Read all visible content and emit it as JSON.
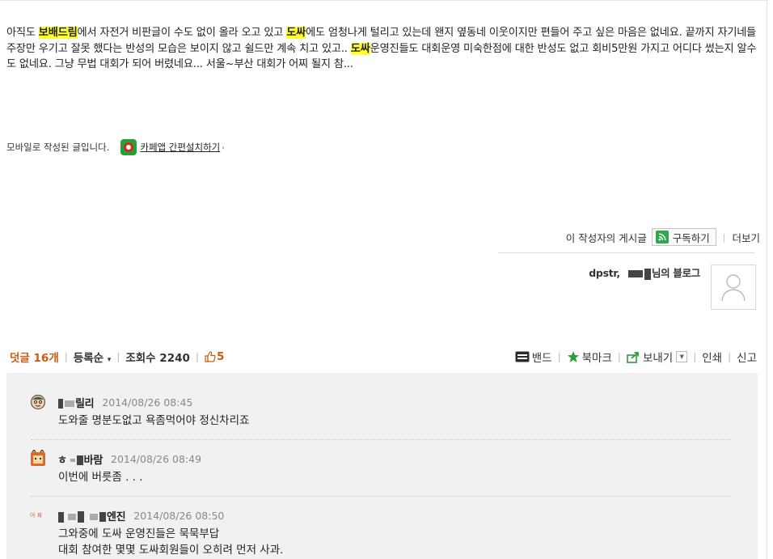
{
  "post": {
    "body_segments": [
      {
        "text": "아직도 ",
        "hl": false
      },
      {
        "text": "보배드림",
        "hl": true
      },
      {
        "text": "에서 자전거 비판글이 수도 없이 올라 오고 있고 ",
        "hl": false
      },
      {
        "text": "도싸",
        "hl": true
      },
      {
        "text": "에도 엄청나게 털리고 있는데 왠지 옆동네 이웃이지만 편들어 주고 싶은 마음은 없네요. 끝까지 자기네들 주장만 우기고 잘못 했다는 반성의 모습은 보이지 않고 쉴드만 계속 치고 있고.. ",
        "hl": false
      },
      {
        "text": "도싸",
        "hl": true
      },
      {
        "text": "운영진들도 대회운영 미숙한점에 대한 반성도 없고 회비5만원 가지고 어디다 썼는지 알수도 없네요. 그냥 무법 대회가 되어 버렸네요... 서울~부산 대회가 어찌 될지 참...",
        "hl": false
      }
    ],
    "mobile_text": "모바일로 작성된 글입니다.",
    "install_link": "카페앱 간편설치하기",
    "install_arrow": "›"
  },
  "author": {
    "posts_label": "이 작성자의 게시글",
    "subscribe_label": "구독하기",
    "more_label": "더보기",
    "blog_prefix": "dpstr,",
    "blog_suffix": "님의 블로그"
  },
  "comment_bar": {
    "count_label": "덧글 16개",
    "order_label": "등록순",
    "views_label": "조회수 2240",
    "likes": "5",
    "band": "밴드",
    "bookmark": "북마크",
    "send": "보내기",
    "print": "인쇄",
    "report": "신고"
  },
  "comments": [
    {
      "nick_a": "",
      "nick_b": "릴리",
      "date": "2014/08/26 08:45",
      "lines": [
        "도와줄 명분도없고 욕좀먹어야 정신차리죠"
      ]
    },
    {
      "nick_a": "ㅎ",
      "nick_b": "바람",
      "date": "2014/08/26 08:49",
      "lines": [
        "이번에 버릇좀 . . ."
      ]
    },
    {
      "nick_a": "",
      "nick_b": "엔진",
      "date": "2014/08/26 08:50",
      "lines": [
        "그와중에 도싸 운영진들은 묵묵부답",
        "대회 참여한 몇몇 도싸회원들이 오히려 먼저 사과."
      ]
    }
  ],
  "colors": {
    "highlight": "#ffff33",
    "accent_orange": "#d05a0e",
    "comment_bg": "#f1f1f1",
    "green": "#2ea84a"
  }
}
